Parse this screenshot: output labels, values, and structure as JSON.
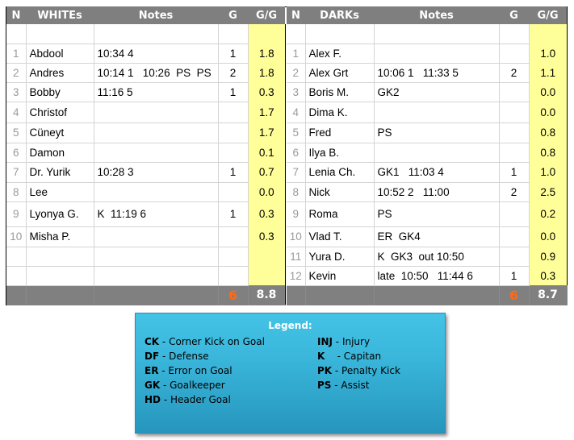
{
  "whites": {
    "headers": {
      "n": "N",
      "team": "WHITEs",
      "notes": "Notes",
      "g": "G",
      "gg": "G/G"
    },
    "rows": [
      {
        "n": "",
        "name": "",
        "notes": "",
        "g": "",
        "gg": ""
      },
      {
        "n": "1",
        "name": "Abdool",
        "notes": "10:34 4",
        "g": "1",
        "gg": "1.8"
      },
      {
        "n": "2",
        "name": "Andres",
        "notes": "10:14 1   10:26  PS  PS",
        "g": "2",
        "gg": "1.8"
      },
      {
        "n": "3",
        "name": "Bobby",
        "notes": "11:16 5",
        "g": "1",
        "gg": "0.3"
      },
      {
        "n": "4",
        "name": "Christof",
        "notes": "",
        "g": "",
        "gg": "1.7"
      },
      {
        "n": "5",
        "name": "Cüneyt",
        "notes": "",
        "g": "",
        "gg": "1.7"
      },
      {
        "n": "6",
        "name": "Damon",
        "notes": "",
        "g": "",
        "gg": "0.1"
      },
      {
        "n": "7",
        "name": "Dr. Yurik",
        "notes": "10:28 3",
        "g": "1",
        "gg": "0.7"
      },
      {
        "n": "8",
        "name": "Lee",
        "notes": "",
        "g": "",
        "gg": "0.0"
      },
      {
        "n": "9",
        "name": "Lyonya G.",
        "notes": "K  11:19 6",
        "g": "1",
        "gg": "0.3"
      },
      {
        "n": "10",
        "name": "Misha P.",
        "notes": "",
        "g": "",
        "gg": "0.3"
      },
      {
        "n": "",
        "name": "",
        "notes": "",
        "g": "",
        "gg": ""
      },
      {
        "n": "",
        "name": "",
        "notes": "",
        "g": "",
        "gg": ""
      }
    ],
    "total_g": "6",
    "total_gg": "8.8"
  },
  "darks": {
    "headers": {
      "n": "N",
      "team": "DARKs",
      "notes": "Notes",
      "g": "G",
      "gg": "G/G"
    },
    "rows": [
      {
        "n": "",
        "name": "",
        "notes": "",
        "g": "",
        "gg": ""
      },
      {
        "n": "1",
        "name": "Alex F.",
        "notes": "",
        "g": "",
        "gg": "1.0"
      },
      {
        "n": "2",
        "name": "Alex Grt",
        "notes": "10:06 1   11:33 5",
        "g": "2",
        "gg": "1.1"
      },
      {
        "n": "3",
        "name": "Boris M.",
        "notes": "GK2",
        "g": "",
        "gg": "0.0"
      },
      {
        "n": "4",
        "name": "Dima K.",
        "notes": "",
        "g": "",
        "gg": "0.0"
      },
      {
        "n": "5",
        "name": "Fred",
        "notes": "PS",
        "g": "",
        "gg": "0.8"
      },
      {
        "n": "6",
        "name": "Ilya B.",
        "notes": "",
        "g": "",
        "gg": "0.8"
      },
      {
        "n": "7",
        "name": "Lenia Ch.",
        "notes": "GK1   11:03 4",
        "g": "1",
        "gg": "1.0"
      },
      {
        "n": "8",
        "name": "Nick",
        "notes": "10:52 2   11:00",
        "g": "2",
        "gg": "2.5"
      },
      {
        "n": "9",
        "name": "Roma",
        "notes": "PS",
        "g": "",
        "gg": "0.2"
      },
      {
        "n": "10",
        "name": "Vlad T.",
        "notes": "ER  GK4",
        "g": "",
        "gg": "0.0"
      },
      {
        "n": "11",
        "name": "Yura D.",
        "notes": "K  GK3  out 10:50",
        "g": "",
        "gg": "0.9"
      },
      {
        "n": "12",
        "name": "Kevin",
        "notes": "late  10:50   11:44 6",
        "g": "1",
        "gg": "0.3"
      }
    ],
    "total_g": "6",
    "total_gg": "8.7"
  },
  "legend": {
    "title": "Legend:",
    "left": [
      {
        "code": "CK",
        "desc": " - Corner Kick on Goal"
      },
      {
        "code": "DF",
        "desc": " - Defense"
      },
      {
        "code": "ER",
        "desc": " - Error on Goal"
      },
      {
        "code": "GK",
        "desc": " - Goalkeeper"
      },
      {
        "code": "HD",
        "desc": " - Header Goal"
      }
    ],
    "right": [
      {
        "code": "INJ",
        "desc": " - Injury"
      },
      {
        "code": "K",
        "desc": "    - Capitan"
      },
      {
        "code": "PK",
        "desc": " - Penalty Kick"
      },
      {
        "code": "PS",
        "desc": " - Assist"
      }
    ]
  },
  "colors": {
    "header_bg": "#7f7f7f",
    "gg_highlight": "#ffff99",
    "total_goals": "#ff6a13",
    "legend_bg": "#3bb7dc"
  }
}
